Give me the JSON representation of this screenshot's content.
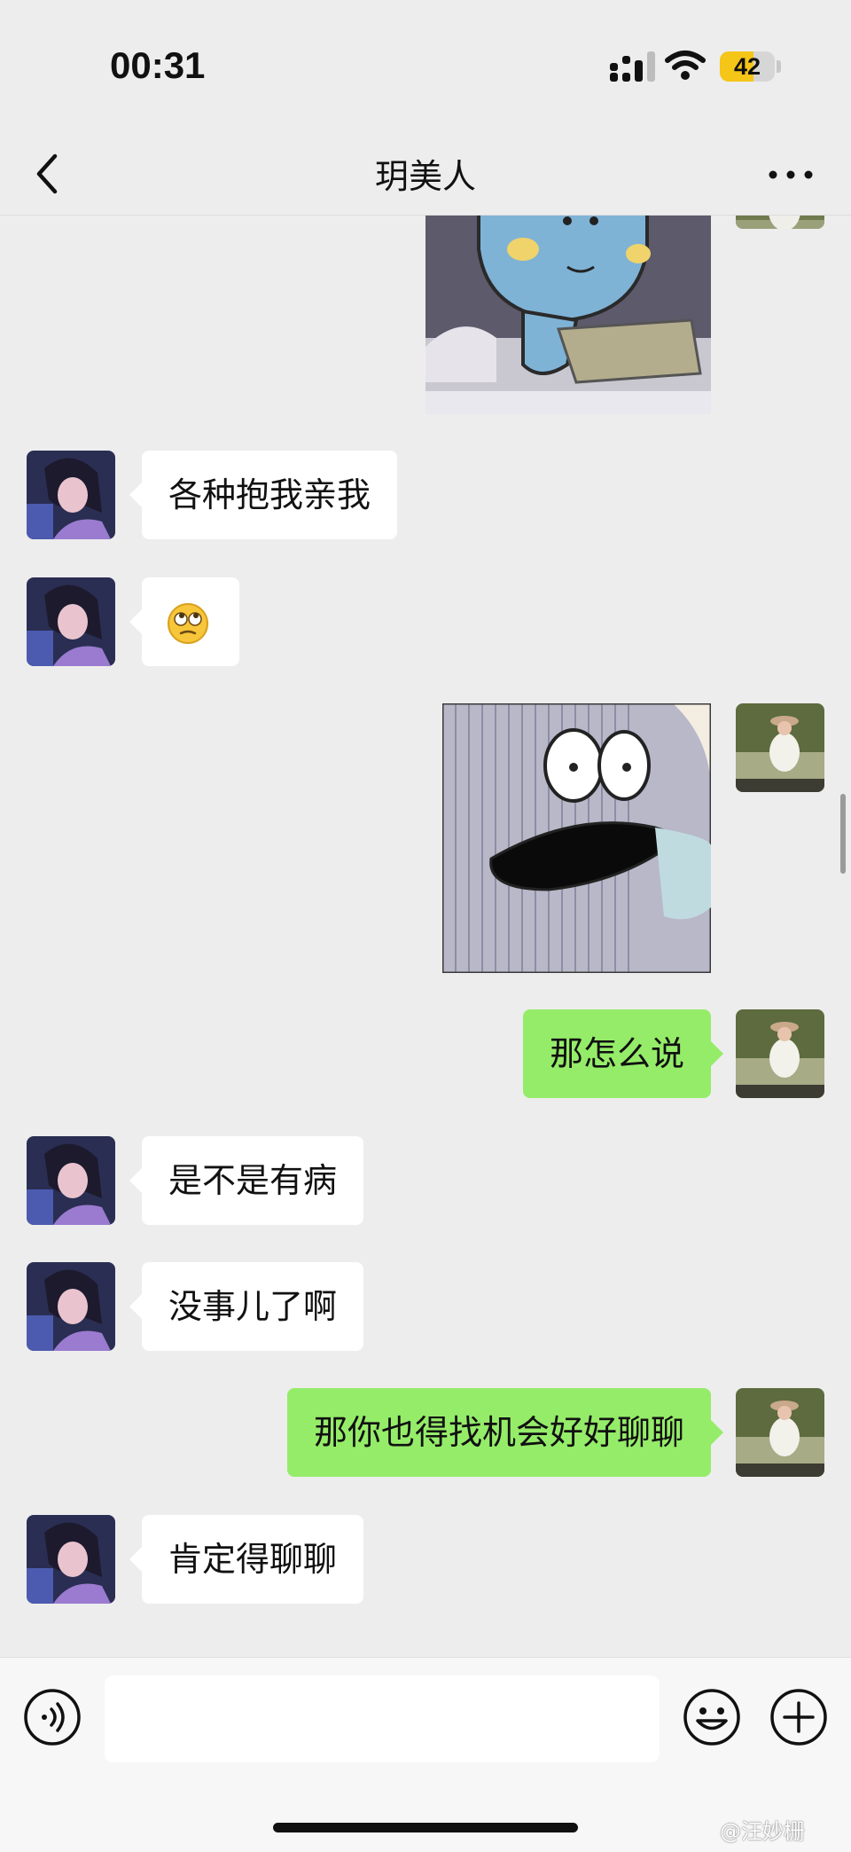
{
  "status_bar": {
    "time": "00:31",
    "battery": "42"
  },
  "nav": {
    "title": "玥美人"
  },
  "messages": [
    {
      "side": "right",
      "type": "sticker",
      "sticker": "blue-creature-sticker"
    },
    {
      "side": "left",
      "type": "text",
      "text": "各种抱我亲我"
    },
    {
      "side": "left",
      "type": "emoji",
      "emoji": "🙄"
    },
    {
      "side": "right",
      "type": "sticker",
      "sticker": "surprised-gray-creature-sticker"
    },
    {
      "side": "right",
      "type": "text",
      "text": "那怎么说"
    },
    {
      "side": "left",
      "type": "text",
      "text": "是不是有病"
    },
    {
      "side": "left",
      "type": "text",
      "text": "没事儿了啊"
    },
    {
      "side": "right",
      "type": "text",
      "text": "那你也得找机会好好聊聊"
    },
    {
      "side": "left",
      "type": "text",
      "text": "肯定得聊聊"
    }
  ],
  "input_bar": {
    "text": ""
  },
  "watermark": "@汪妙栅",
  "colors": {
    "background": "#ededed",
    "sent_bubble": "#95ec69",
    "received_bubble": "#ffffff"
  }
}
